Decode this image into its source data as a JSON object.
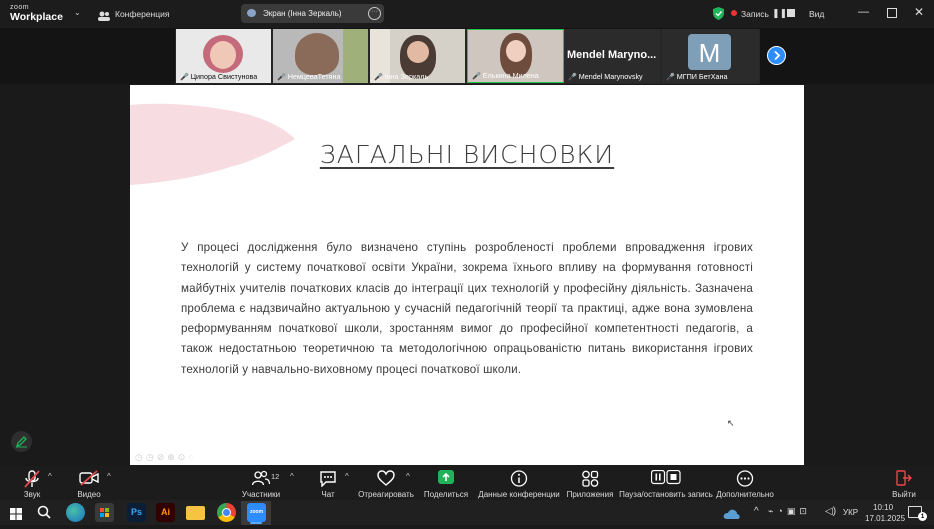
{
  "app": {
    "logo_top": "zoom",
    "logo_bottom": "Workplace",
    "meeting_label": "Конференция",
    "share_label": "Экран (Інна Зеркаль)",
    "record_label": "Запись",
    "view_label": "Вид"
  },
  "participants": [
    {
      "name": "Ципора Свистунова",
      "muted": true
    },
    {
      "name": "НемцеваТетяна",
      "muted": true
    },
    {
      "name": "Інна Зеркаль",
      "muted": true
    },
    {
      "name": "Елькина Милена",
      "muted": true,
      "active": true
    },
    {
      "name": "Mendel Marynovsky",
      "muted": true,
      "display_text": "Mendel Maryno..."
    },
    {
      "name": "МГПИ БетХана",
      "muted": true,
      "avatar_letter": "M"
    }
  ],
  "slide": {
    "title": "ЗАГАЛЬНІ ВИСНОВКИ",
    "body": "У процесі дослідження було визначено ступінь розробленості проблеми впровадження ігрових технологій у систему початкової освіти України, зокрема їхнього впливу на формування готовності майбутніх учителів початкових класів до інтеграції цих технологій у професійну діяльність. Зазначена проблема є надзвичайно актуальною у сучасній педагогічній теорії та практиці, адже вона зумовлена реформуванням початкової школи, зростанням вимог до професійної компетентності педагогів, а також недостатньою теоретичною та методологічною опрацьованістю питань використання ігрових технологій у навчально-виховному процесі початкової школи."
  },
  "toolbar": {
    "audio": "Звук",
    "video": "Видео",
    "participants": "Участники",
    "participants_count": "12",
    "chat": "Чат",
    "react": "Отреагировать",
    "share": "Поделиться",
    "info": "Данные конференции",
    "apps": "Приложения",
    "record": "Пауза/остановить запись",
    "more": "Дополнительно",
    "leave": "Выйти"
  },
  "taskbar": {
    "lang": "УКР",
    "time": "10:10",
    "date": "17.01.2025",
    "notif_count": "1",
    "apps": [
      "Ps",
      "Ai"
    ]
  },
  "colors": {
    "accent_green": "#1fb45a",
    "active_border": "#23c552",
    "leave_red": "#e5484d",
    "zoom_blue": "#2d8cff"
  }
}
